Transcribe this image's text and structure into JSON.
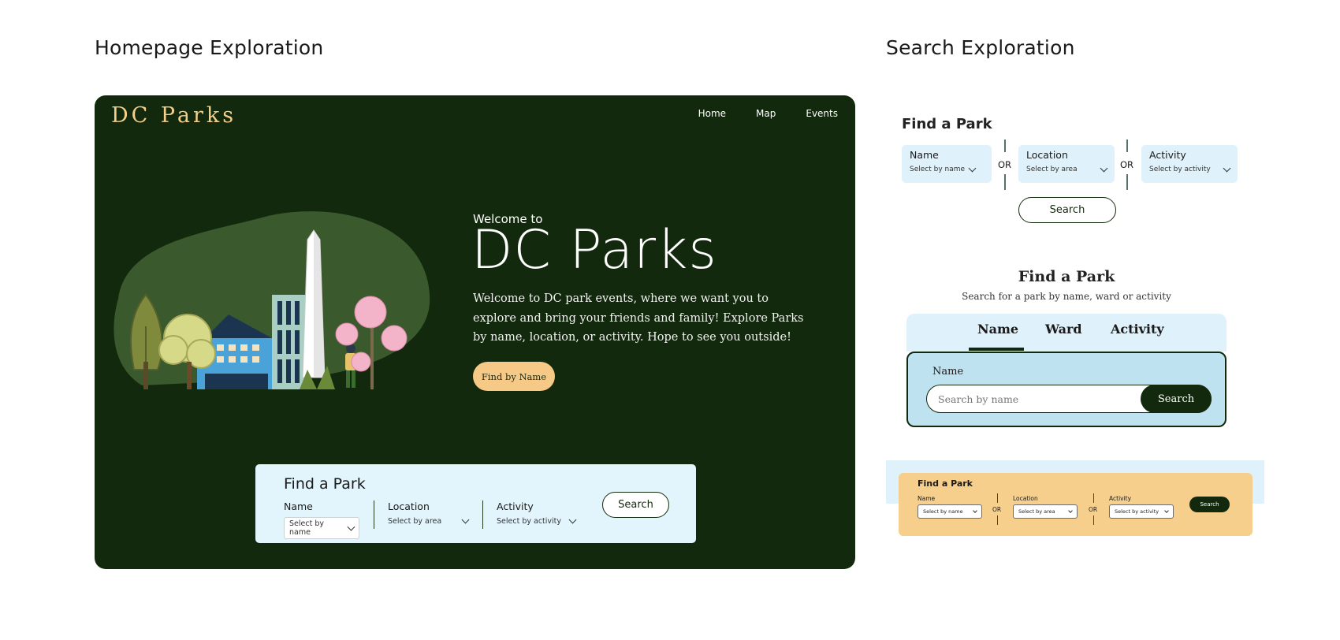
{
  "sections": {
    "homepage_title": "Homepage Exploration",
    "search_title": "Search Exploration"
  },
  "home": {
    "logo": "DC Parks",
    "nav": [
      "Home",
      "Map",
      "Events"
    ],
    "welcome_small": "Welcome to",
    "hero_title": "DC Parks",
    "description": "Welcome to DC park events, where we want you to explore and bring your friends and family! Explore Parks by name, location, or activity. Hope to see you outside!",
    "cta": "Find by Name",
    "find_panel": {
      "title": "Find a Park",
      "name_label": "Name",
      "name_placeholder": "Select by name",
      "location_label": "Location",
      "location_placeholder": "Select by area",
      "activity_label": "Activity",
      "activity_placeholder": "Select by activity",
      "search": "Search"
    }
  },
  "search_v1": {
    "title": "Find a Park",
    "name_label": "Name",
    "name_placeholder": "Select by name",
    "or": "OR",
    "location_label": "Location",
    "location_placeholder": "Select by area",
    "activity_label": "Activity",
    "activity_placeholder": "Select by activity",
    "search": "Search"
  },
  "search_v2": {
    "title": "Find a Park",
    "subtitle": "Search for a park by name, ward or activity",
    "tabs": [
      "Name",
      "Ward",
      "Activity"
    ],
    "active_tab": "Name",
    "panel_label": "Name",
    "input_placeholder": "Search by name",
    "search": "Search"
  },
  "search_v3": {
    "title": "Find a Park",
    "name_label": "Name",
    "name_placeholder": "Select by name",
    "or": "OR",
    "location_label": "Location",
    "location_placeholder": "Select by area",
    "activity_label": "Activity",
    "activity_placeholder": "Select by activity",
    "search": "Search"
  },
  "colors": {
    "dark_green": "#13290d",
    "logo_gold": "#f3cf8a",
    "cta_peach": "#f7c987",
    "light_blue": "#e3f5fc",
    "panel_blue": "#bfe2f1"
  }
}
